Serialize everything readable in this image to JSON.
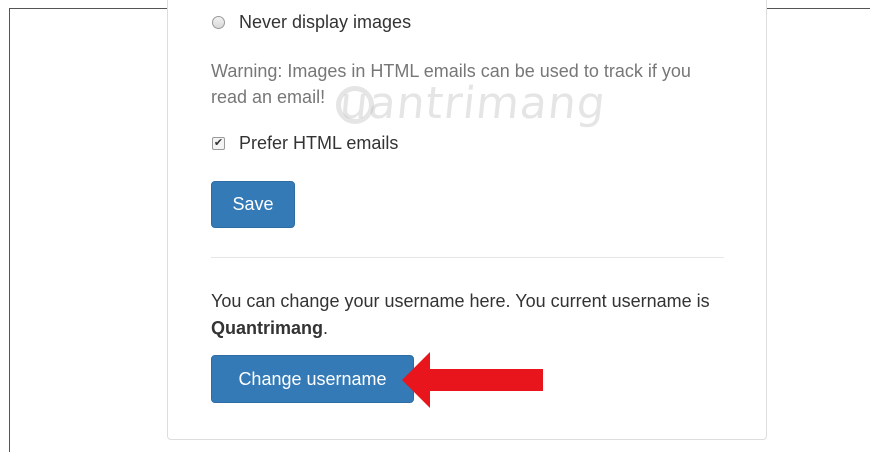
{
  "settings": {
    "radio_never_label": "Never display images",
    "warning_text": "Warning: Images in HTML emails can be used to track if you read an email!",
    "prefer_html_label": "Prefer HTML emails",
    "prefer_html_checked": true,
    "save_label": "Save"
  },
  "username": {
    "info_prefix": "You can change your username here. You current username is ",
    "current_username": "Quantrimang",
    "info_suffix": ".",
    "change_label": "Change username"
  },
  "watermark": {
    "text": "uantrimang"
  },
  "colors": {
    "button_primary": "#337ab7",
    "arrow": "#e8161c"
  }
}
